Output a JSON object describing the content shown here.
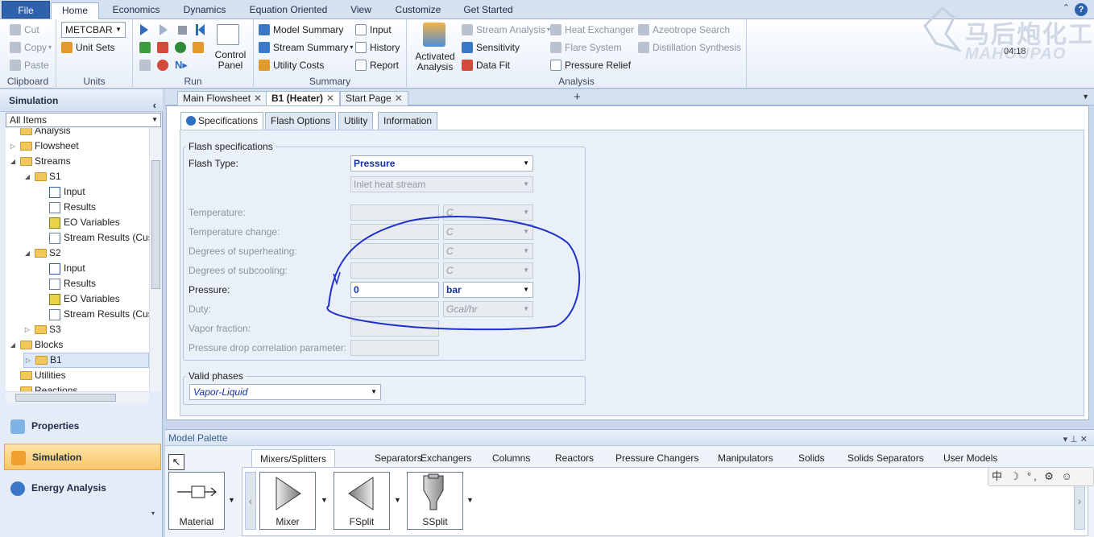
{
  "ribbon_tabs": [
    "File",
    "Home",
    "Economics",
    "Dynamics",
    "Equation Oriented",
    "View",
    "Customize",
    "Get Started"
  ],
  "ribbon": {
    "clipboard": {
      "label": "Clipboard",
      "cut": "Cut",
      "copy": "Copy",
      "paste": "Paste"
    },
    "units": {
      "label": "Units",
      "unit_set_value": "METCBAR",
      "unit_sets": "Unit Sets"
    },
    "run": {
      "label": "Run",
      "control_panel": "Control Panel"
    },
    "summary": {
      "label": "Summary",
      "model_summary": "Model Summary",
      "stream_summary": "Stream Summary",
      "utility_costs": "Utility Costs",
      "input": "Input",
      "history": "History",
      "report": "Report"
    },
    "analysis": {
      "label": "Analysis",
      "activated_analysis": "Activated Analysis",
      "stream_analysis": "Stream Analysis",
      "sensitivity": "Sensitivity",
      "data_fit": "Data Fit",
      "heat_exchanger": "Heat Exchanger",
      "flare_system": "Flare System",
      "pressure_relief": "Pressure Relief",
      "azeotrope_search": "Azeotrope Search",
      "distillation_synthesis": "Distillation Synthesis"
    },
    "help": "?"
  },
  "watermark": {
    "cn": "马后炮化工",
    "en": "MAHOUPAO",
    "clock": "04:18"
  },
  "nav": {
    "title": "Simulation",
    "filter": "All Items",
    "tree": [
      {
        "label": "Analysis",
        "level": 1,
        "type": "folder",
        "exp": ""
      },
      {
        "label": "Flowsheet",
        "level": 1,
        "type": "folder",
        "exp": "▷"
      },
      {
        "label": "Streams",
        "level": 1,
        "type": "folder",
        "exp": "◢"
      },
      {
        "label": "S1",
        "level": 2,
        "type": "folder",
        "exp": "◢"
      },
      {
        "label": "Input",
        "level": 3,
        "type": "input",
        "exp": ""
      },
      {
        "label": "Results",
        "level": 3,
        "type": "doc",
        "exp": ""
      },
      {
        "label": "EO Variables",
        "level": 3,
        "type": "eo",
        "exp": ""
      },
      {
        "label": "Stream Results (Cus",
        "level": 3,
        "type": "doc",
        "exp": ""
      },
      {
        "label": "S2",
        "level": 2,
        "type": "folder",
        "exp": "◢"
      },
      {
        "label": "Input",
        "level": 3,
        "type": "input",
        "exp": ""
      },
      {
        "label": "Results",
        "level": 3,
        "type": "doc",
        "exp": ""
      },
      {
        "label": "EO Variables",
        "level": 3,
        "type": "eo",
        "exp": ""
      },
      {
        "label": "Stream Results (Cus",
        "level": 3,
        "type": "doc",
        "exp": ""
      },
      {
        "label": "S3",
        "level": 2,
        "type": "folder",
        "exp": "▷"
      },
      {
        "label": "Blocks",
        "level": 1,
        "type": "folder",
        "exp": "◢"
      },
      {
        "label": "B1",
        "level": 2,
        "type": "folder",
        "exp": "▷",
        "selected": true
      },
      {
        "label": "Utilities",
        "level": 1,
        "type": "folder",
        "exp": ""
      },
      {
        "label": "Reactions",
        "level": 1,
        "type": "folder",
        "exp": ""
      }
    ],
    "buttons": [
      "Properties",
      "Simulation",
      "Energy Analysis"
    ]
  },
  "doc_tabs": [
    "Main Flowsheet",
    "B1 (Heater)",
    "Start Page"
  ],
  "form": {
    "tabs": [
      "Specifications",
      "Flash Options",
      "Utility",
      "Information"
    ],
    "flash_specs_title": "Flash specifications",
    "flash_type_label": "Flash Type:",
    "flash_type_value": "Pressure",
    "flash_type2_value": "Inlet heat stream",
    "rows": [
      {
        "label": "Temperature:",
        "value": "",
        "unit": "C",
        "enabled": false
      },
      {
        "label": "Temperature change:",
        "value": "",
        "unit": "C",
        "enabled": false
      },
      {
        "label": "Degrees of superheating:",
        "value": "",
        "unit": "C",
        "enabled": false
      },
      {
        "label": "Degrees of subcooling:",
        "value": "",
        "unit": "C",
        "enabled": false
      },
      {
        "label": "Pressure:",
        "value": "0",
        "unit": "bar",
        "enabled": true
      },
      {
        "label": "Duty:",
        "value": "",
        "unit": "Gcal/hr",
        "enabled": false
      },
      {
        "label": "Vapor fraction:",
        "value": "",
        "unit": "",
        "enabled": false
      },
      {
        "label": "Pressure drop correlation parameter:",
        "value": "",
        "unit": "",
        "enabled": false
      }
    ],
    "valid_phases_title": "Valid phases",
    "valid_phases_value": "Vapor-Liquid"
  },
  "palette": {
    "title": "Model Palette",
    "tabs": [
      "Mixers/Splitters",
      "Separators",
      "Exchangers",
      "Columns",
      "Reactors",
      "Pressure Changers",
      "Manipulators",
      "Solids",
      "Solids Separators",
      "User Models"
    ],
    "items": [
      "Material",
      "Mixer",
      "FSplit",
      "SSplit"
    ]
  },
  "ime": "中 ☽ °, ⚙ ☺"
}
